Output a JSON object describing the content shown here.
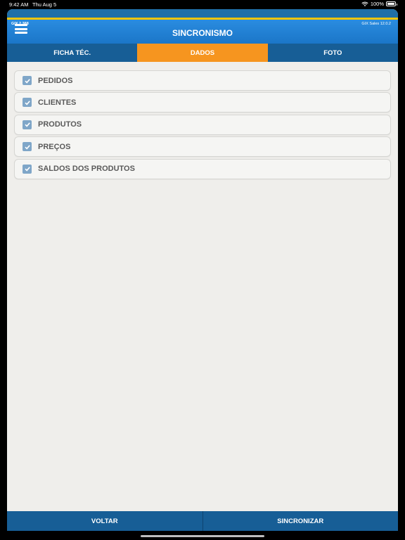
{
  "status_bar": {
    "time": "9:42 AM",
    "date": "Thu Aug 5",
    "battery": "100%",
    "icons": [
      "wifi-icon",
      "battery-icon"
    ]
  },
  "header": {
    "version_left": "GIX 2.388",
    "version_right": "GIX Sales 12.0.2",
    "title": "SINCRONISMO",
    "menu_icon": "hamburger-menu-icon"
  },
  "tabs": [
    {
      "label": "FICHA TÉC.",
      "active": false
    },
    {
      "label": "DADOS",
      "active": true
    },
    {
      "label": "FOTO",
      "active": false
    }
  ],
  "items": [
    {
      "label": "PEDIDOS",
      "checked": true
    },
    {
      "label": "CLIENTES",
      "checked": true
    },
    {
      "label": "PRODUTOS",
      "checked": true
    },
    {
      "label": "PREÇOS",
      "checked": true
    },
    {
      "label": "SALDOS DOS PRODUTOS",
      "checked": true
    }
  ],
  "footer": {
    "back_label": "VOLTAR",
    "sync_label": "SINCRONIZAR"
  },
  "colors": {
    "header_blue": "#1b76c8",
    "tab_bar": "#175e96",
    "tab_active": "#f6951f",
    "accent_yellow": "#f5c400",
    "checkbox": "#7fa6c8"
  }
}
